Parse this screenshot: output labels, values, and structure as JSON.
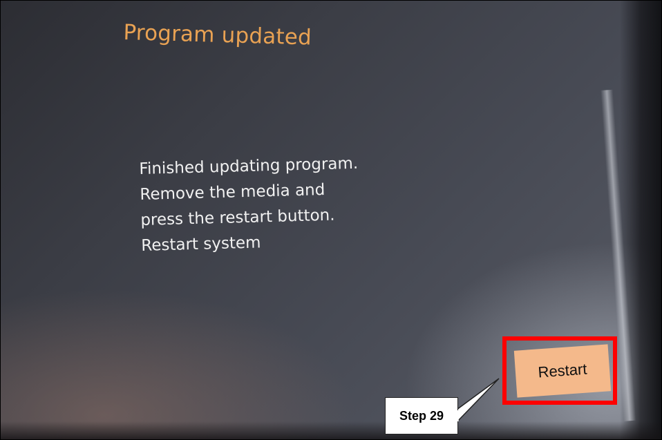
{
  "screen": {
    "title": "Program updated",
    "message_lines": [
      "Finished updating program.",
      "Remove the media and",
      "press the restart button.",
      "Restart system"
    ]
  },
  "actions": {
    "restart_label": "Restart"
  },
  "annotation": {
    "step_label": "Step 29",
    "highlight_color": "#ff0000"
  },
  "colors": {
    "title": "#e9a253",
    "message": "#f1f1f1",
    "button_bg": "#f4b98b"
  }
}
